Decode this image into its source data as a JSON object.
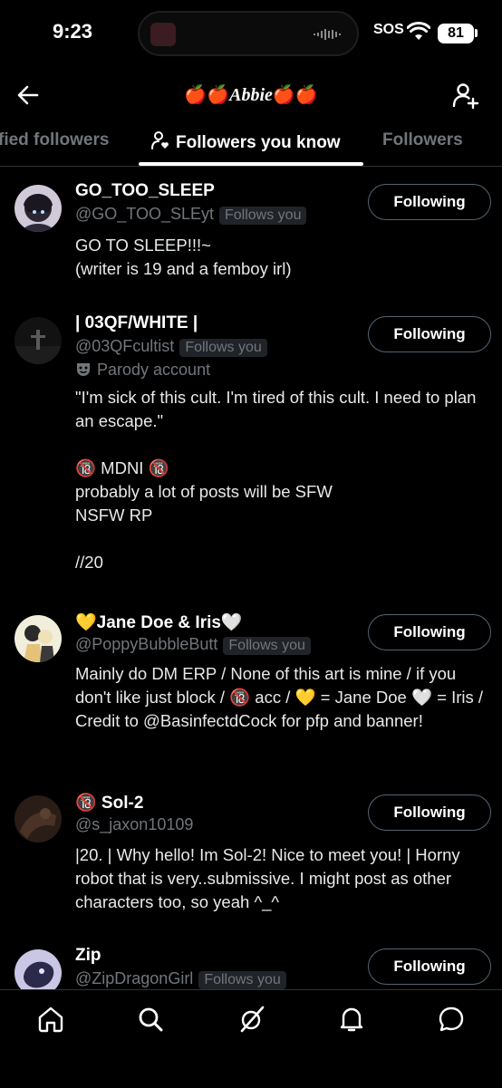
{
  "status_bar": {
    "time": "9:23",
    "sos": "SOS",
    "battery": "81"
  },
  "header": {
    "title_prefix": "🍎🍎",
    "title_name": "Abbie",
    "title_suffix": "🍎🍎"
  },
  "tabs": [
    {
      "label": "fied followers",
      "active": false
    },
    {
      "label": "Followers you know",
      "active": true
    },
    {
      "label": "Followers",
      "active": false
    }
  ],
  "accounts": [
    {
      "display_name": "GO_TOO_SLEEP",
      "handle": "@GO_TOO_SLEyt",
      "follows_you": "Follows you",
      "bio": "GO TO SLEEP!!!~\n(writer is 19 and a femboy irl)",
      "button": "Following"
    },
    {
      "display_name": "| 03QF/WHITE |",
      "handle": "@03QFcultist",
      "follows_you": "Follows you",
      "parody": "Parody account",
      "bio": "\"I'm sick of this cult. I'm tired of this cult. I need to plan an escape.\"\n\n🔞 MDNI 🔞\nprobably a lot of posts will be SFW\nNSFW RP\n\n//20",
      "button": "Following"
    },
    {
      "display_name": "💛Jane Doe & Iris🤍",
      "handle": "@PoppyBubbleButt",
      "follows_you": "Follows you",
      "bio": "Mainly do DM ERP / None of this art is mine / if you don't like just block / 🔞 acc / 💛 = Jane Doe 🤍 = Iris / Credit to @BasinfectdCock for pfp and banner!",
      "button": "Following"
    },
    {
      "display_name": "🔞 Sol-2",
      "handle": "@s_jaxon10109",
      "bio": "|20. | Why hello! Im Sol-2! Nice to meet you! | Horny robot that is very..submissive. I might post as other characters too, so yeah ^_^",
      "button": "Following"
    },
    {
      "display_name": "Zip",
      "handle": "@ZipDragonGirl",
      "follows_you": "Follows you",
      "button": "Following"
    }
  ],
  "bottom_nav": [
    "home-icon",
    "search-icon",
    "grok-icon",
    "notifications-icon",
    "messages-icon"
  ]
}
